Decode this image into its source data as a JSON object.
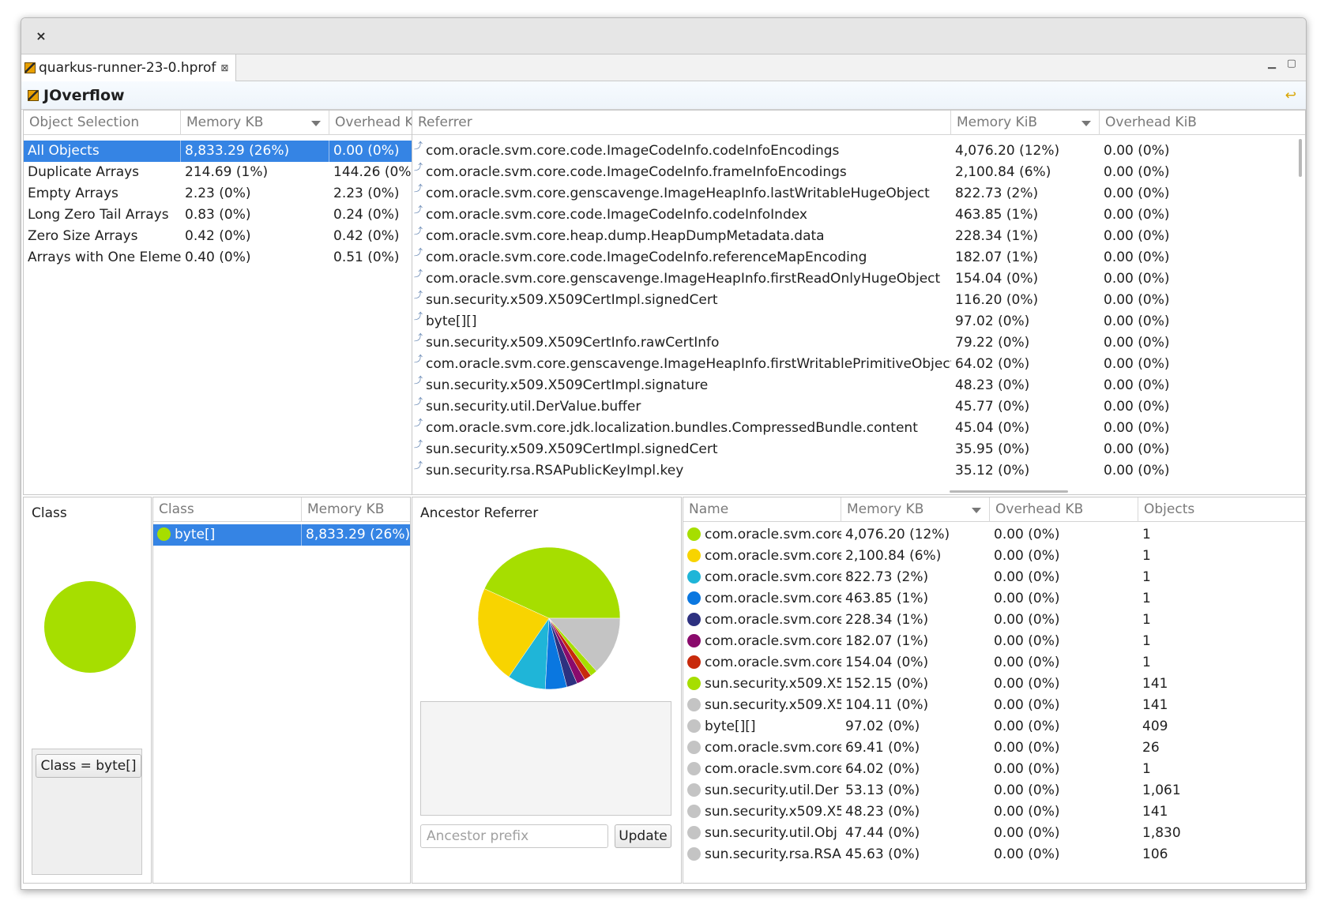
{
  "window": {
    "close_glyph": "×"
  },
  "editor_tab": {
    "title": "quarkus-runner-23-0.hprof",
    "close_glyph": "⊠"
  },
  "view": {
    "title": "JOverflow"
  },
  "object_selection": {
    "headers": [
      "Object Selection",
      "Memory KB",
      "Overhead KB"
    ],
    "rows": [
      [
        "All Objects",
        "8,833.29 (26%)",
        "0.00 (0%)"
      ],
      [
        "Duplicate Arrays",
        "214.69 (1%)",
        "144.26 (0%)"
      ],
      [
        "Empty Arrays",
        "2.23 (0%)",
        "2.23 (0%)"
      ],
      [
        "Long Zero Tail Arrays",
        "0.83 (0%)",
        "0.24 (0%)"
      ],
      [
        "Zero Size Arrays",
        "0.42 (0%)",
        "0.42 (0%)"
      ],
      [
        "Arrays with One Elemen",
        "0.40 (0%)",
        "0.51 (0%)"
      ]
    ]
  },
  "referrer": {
    "headers": [
      "Referrer",
      "Memory KiB",
      "Overhead KiB"
    ],
    "rows": [
      [
        "com.oracle.svm.core.code.ImageCodeInfo.codeInfoEncodings",
        "4,076.20 (12%)",
        "0.00 (0%)"
      ],
      [
        "com.oracle.svm.core.code.ImageCodeInfo.frameInfoEncodings",
        "2,100.84 (6%)",
        "0.00 (0%)"
      ],
      [
        "com.oracle.svm.core.genscavenge.ImageHeapInfo.lastWritableHugeObject",
        "822.73 (2%)",
        "0.00 (0%)"
      ],
      [
        "com.oracle.svm.core.code.ImageCodeInfo.codeInfoIndex",
        "463.85 (1%)",
        "0.00 (0%)"
      ],
      [
        "com.oracle.svm.core.heap.dump.HeapDumpMetadata.data",
        "228.34 (1%)",
        "0.00 (0%)"
      ],
      [
        "com.oracle.svm.core.code.ImageCodeInfo.referenceMapEncoding",
        "182.07 (1%)",
        "0.00 (0%)"
      ],
      [
        "com.oracle.svm.core.genscavenge.ImageHeapInfo.firstReadOnlyHugeObject",
        "154.04 (0%)",
        "0.00 (0%)"
      ],
      [
        "sun.security.x509.X509CertImpl.signedCert",
        "116.20 (0%)",
        "0.00 (0%)"
      ],
      [
        "byte[][]",
        "97.02 (0%)",
        "0.00 (0%)"
      ],
      [
        "sun.security.x509.X509CertInfo.rawCertInfo",
        "79.22 (0%)",
        "0.00 (0%)"
      ],
      [
        "com.oracle.svm.core.genscavenge.ImageHeapInfo.firstWritablePrimitiveObject",
        "64.02 (0%)",
        "0.00 (0%)"
      ],
      [
        "sun.security.x509.X509CertImpl.signature",
        "48.23 (0%)",
        "0.00 (0%)"
      ],
      [
        "sun.security.util.DerValue.buffer",
        "45.77 (0%)",
        "0.00 (0%)"
      ],
      [
        "com.oracle.svm.core.jdk.localization.bundles.CompressedBundle.content",
        "45.04 (0%)",
        "0.00 (0%)"
      ],
      [
        "sun.security.x509.X509CertImpl.signedCert",
        "35.95 (0%)",
        "0.00 (0%)"
      ],
      [
        "sun.security.rsa.RSAPublicKeyImpl.key",
        "35.12 (0%)",
        "0.00 (0%)"
      ]
    ]
  },
  "class_pane": {
    "title": "Class",
    "filter_button": "Class = byte[]",
    "pie_color": "#a6de00"
  },
  "class_table": {
    "headers": [
      "Class",
      "Memory KB"
    ],
    "rows": [
      {
        "name": "byte[]",
        "memory": "8,833.29 (26%)",
        "color": "#a6de00"
      }
    ]
  },
  "ancestor_pane": {
    "title": "Ancestor Referrer",
    "input_placeholder": "Ancestor prefix",
    "update_button": "Update"
  },
  "chart_data": {
    "type": "pie",
    "values": [
      4076.2,
      2100.84,
      822.73,
      463.85,
      228.34,
      182.07,
      154.04,
      152.15,
      1260.0
    ],
    "colors": [
      "#a6de00",
      "#f8d400",
      "#1fb5d8",
      "#0a77e0",
      "#2d3180",
      "#8a0a6c",
      "#c82a0c",
      "#a6de00",
      "#c4c4c4"
    ]
  },
  "name_table": {
    "headers": [
      "Name",
      "Memory KB",
      "Overhead KB",
      "Objects"
    ],
    "rows": [
      {
        "name": "com.oracle.svm.core",
        "memory": "4,076.20 (12%)",
        "overhead": "0.00 (0%)",
        "objects": "1",
        "color": "#a6de00"
      },
      {
        "name": "com.oracle.svm.core",
        "memory": "2,100.84 (6%)",
        "overhead": "0.00 (0%)",
        "objects": "1",
        "color": "#f8d400"
      },
      {
        "name": "com.oracle.svm.core",
        "memory": "822.73 (2%)",
        "overhead": "0.00 (0%)",
        "objects": "1",
        "color": "#1fb5d8"
      },
      {
        "name": "com.oracle.svm.core",
        "memory": "463.85 (1%)",
        "overhead": "0.00 (0%)",
        "objects": "1",
        "color": "#0a77e0"
      },
      {
        "name": "com.oracle.svm.core",
        "memory": "228.34 (1%)",
        "overhead": "0.00 (0%)",
        "objects": "1",
        "color": "#2d3180"
      },
      {
        "name": "com.oracle.svm.core",
        "memory": "182.07 (1%)",
        "overhead": "0.00 (0%)",
        "objects": "1",
        "color": "#8a0a6c"
      },
      {
        "name": "com.oracle.svm.core",
        "memory": "154.04 (0%)",
        "overhead": "0.00 (0%)",
        "objects": "1",
        "color": "#c82a0c"
      },
      {
        "name": "sun.security.x509.X5",
        "memory": "152.15 (0%)",
        "overhead": "0.00 (0%)",
        "objects": "141",
        "color": "#a6de00"
      },
      {
        "name": "sun.security.x509.X5",
        "memory": "104.11 (0%)",
        "overhead": "0.00 (0%)",
        "objects": "141",
        "color": "#c4c4c4"
      },
      {
        "name": "byte[][]",
        "memory": "97.02 (0%)",
        "overhead": "0.00 (0%)",
        "objects": "409",
        "color": "#c4c4c4"
      },
      {
        "name": "com.oracle.svm.core",
        "memory": "69.41 (0%)",
        "overhead": "0.00 (0%)",
        "objects": "26",
        "color": "#c4c4c4"
      },
      {
        "name": "com.oracle.svm.core",
        "memory": "64.02 (0%)",
        "overhead": "0.00 (0%)",
        "objects": "1",
        "color": "#c4c4c4"
      },
      {
        "name": "sun.security.util.Der",
        "memory": "53.13 (0%)",
        "overhead": "0.00 (0%)",
        "objects": "1,061",
        "color": "#c4c4c4"
      },
      {
        "name": "sun.security.x509.X5",
        "memory": "48.23 (0%)",
        "overhead": "0.00 (0%)",
        "objects": "141",
        "color": "#c4c4c4"
      },
      {
        "name": "sun.security.util.Obj",
        "memory": "47.44 (0%)",
        "overhead": "0.00 (0%)",
        "objects": "1,830",
        "color": "#c4c4c4"
      },
      {
        "name": "sun.security.rsa.RSAI",
        "memory": "45.63 (0%)",
        "overhead": "0.00 (0%)",
        "objects": "106",
        "color": "#c4c4c4"
      }
    ]
  }
}
